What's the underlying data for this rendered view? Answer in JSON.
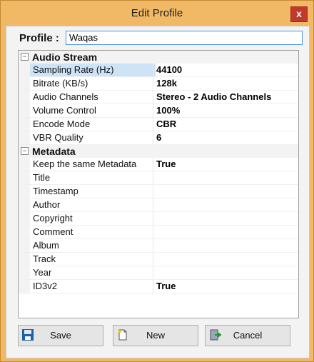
{
  "window": {
    "title": "Edit Profile",
    "close": "x"
  },
  "profile": {
    "label": "Profile :",
    "value": "Waqas"
  },
  "grid": {
    "sections": [
      {
        "title": "Audio Stream",
        "rows": [
          {
            "name": "Sampling Rate (Hz)",
            "value": "44100"
          },
          {
            "name": "Bitrate (KB/s)",
            "value": "128k"
          },
          {
            "name": "Audio Channels",
            "value": "Stereo - 2 Audio Channels"
          },
          {
            "name": "Volume Control",
            "value": "100%"
          },
          {
            "name": "Encode Mode",
            "value": "CBR"
          },
          {
            "name": "VBR Quality",
            "value": "6"
          }
        ]
      },
      {
        "title": "Metadata",
        "rows": [
          {
            "name": "Keep the same Metadata",
            "value": "True"
          },
          {
            "name": "Title",
            "value": ""
          },
          {
            "name": "Timestamp",
            "value": ""
          },
          {
            "name": "Author",
            "value": ""
          },
          {
            "name": "Copyright",
            "value": ""
          },
          {
            "name": "Comment",
            "value": ""
          },
          {
            "name": "Album",
            "value": ""
          },
          {
            "name": "Track",
            "value": ""
          },
          {
            "name": "Year",
            "value": ""
          },
          {
            "name": "ID3v2",
            "value": "True"
          }
        ]
      }
    ]
  },
  "buttons": {
    "save": "Save",
    "new": "New",
    "cancel": "Cancel"
  }
}
